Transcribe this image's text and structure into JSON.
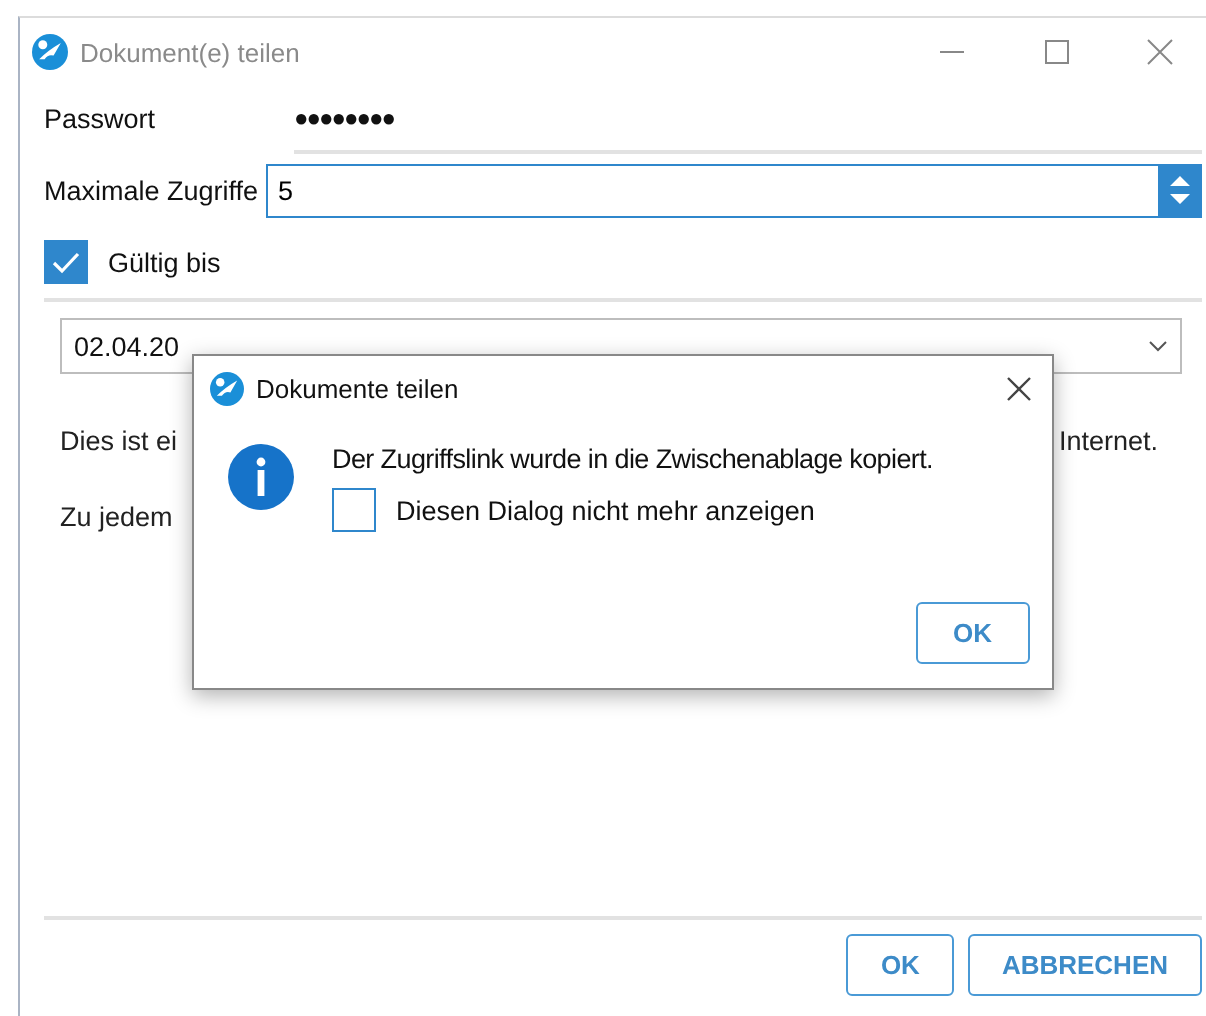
{
  "window": {
    "title": "Dokument(e) teilen"
  },
  "password": {
    "label": "Passwort",
    "value": "●●●●●●●●"
  },
  "max_access": {
    "label": "Maximale Zugriffe",
    "value": "5"
  },
  "valid_until": {
    "label": "Gültig bis",
    "checked": true
  },
  "date_field": {
    "value": "02.04.20"
  },
  "info_lines": [
    {
      "left": "Dies ist ei",
      "right": "Internet."
    },
    {
      "left": "Zu jedem"
    }
  ],
  "buttons": [
    "OK",
    "ABBRECHEN"
  ],
  "dialog": {
    "title": "Dokumente teilen",
    "message": "Der Zugriffslink wurde in die Zwischenablage kopiert.",
    "checkbox": {
      "label": "Diesen Dialog nicht mehr anzeigen",
      "checked": false
    },
    "button": "OK"
  }
}
